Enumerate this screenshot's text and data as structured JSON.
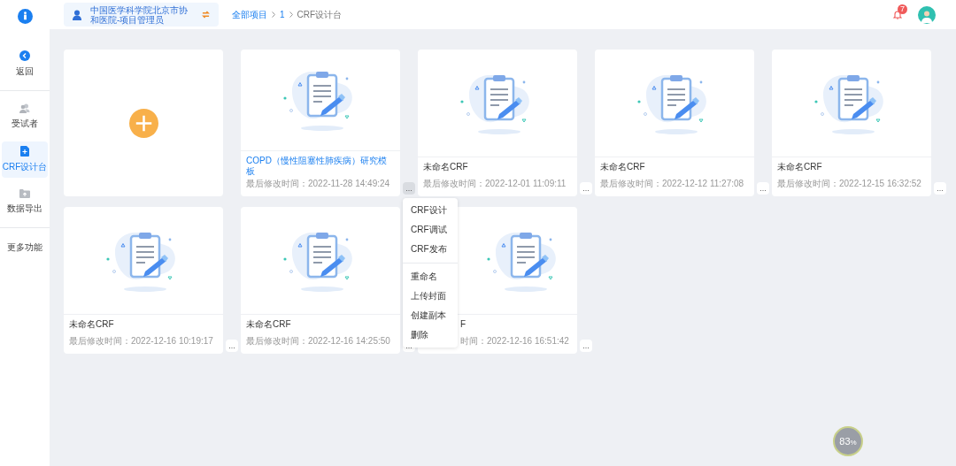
{
  "sidebar": {
    "groups": [
      [
        {
          "kind": "back",
          "label": "返回",
          "selected": false
        }
      ],
      [
        {
          "kind": "users",
          "label": "受试者",
          "selected": false
        },
        {
          "kind": "design",
          "label": "CRF设计台",
          "selected": true
        },
        {
          "kind": "export",
          "label": "数据导出",
          "selected": false
        }
      ],
      [
        {
          "kind": "more",
          "label": "更多功能",
          "selected": false
        }
      ]
    ]
  },
  "topbar": {
    "project": "中国医学科学院北京市协和医院-项目管理员",
    "breadcrumb": [
      {
        "label": "全部项目",
        "link": true
      },
      {
        "label": "1",
        "link": true
      },
      {
        "label": "CRF设计台",
        "link": false
      }
    ],
    "notifications": "7"
  },
  "cards": [
    {
      "kind": "add"
    },
    {
      "kind": "crf",
      "title": "COPD（慢性阻塞性肺疾病）研究模板",
      "linked": true,
      "modified": "最后修改时间：2022-11-28 14:49:24",
      "more": "...",
      "menu_open": true
    },
    {
      "kind": "crf",
      "title": "未命名CRF",
      "linked": false,
      "modified": "最后修改时间：2022-12-01 11:09:11",
      "more": "...",
      "menu_open": false
    },
    {
      "kind": "crf",
      "title": "未命名CRF",
      "linked": false,
      "modified": "最后修改时间：2022-12-12 11:27:08",
      "more": "...",
      "menu_open": false
    },
    {
      "kind": "crf",
      "title": "未命名CRF",
      "linked": false,
      "modified": "最后修改时间：2022-12-15 16:32:52",
      "more": "...",
      "menu_open": false
    },
    {
      "kind": "crf",
      "title": "未命名CRF",
      "linked": false,
      "modified": "最后修改时间：2022-12-16 10:19:17",
      "more": "...",
      "menu_open": false
    },
    {
      "kind": "crf",
      "title": "未命名CRF",
      "linked": false,
      "modified": "最后修改时间：2022-12-16 14:25:50",
      "more": "...",
      "menu_open": false
    },
    {
      "kind": "crf",
      "title": "F",
      "linked": false,
      "covered": true,
      "modified": "时间：2022-12-16 16:51:42",
      "more": "...",
      "menu_open": false
    }
  ],
  "context_menu": {
    "groups": [
      [
        "CRF设计",
        "CRF调试",
        "CRF发布"
      ],
      [
        "重命名",
        "上传封面",
        "创建副本",
        "删除"
      ]
    ]
  },
  "memory_widget": {
    "reading": "83",
    "unit": "%"
  }
}
